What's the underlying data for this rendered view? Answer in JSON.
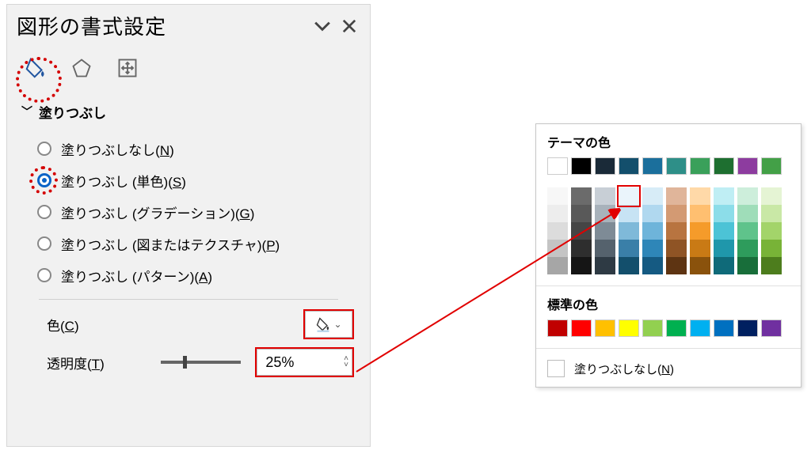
{
  "pane": {
    "title": "図形の書式設定",
    "section_fill": "塗りつぶし",
    "radios": {
      "none": {
        "pre": "塗りつぶしなし(",
        "acc": "N",
        "post": ")"
      },
      "solid": {
        "pre": "塗りつぶし (単色)(",
        "acc": "S",
        "post": ")"
      },
      "gradient": {
        "pre": "塗りつぶし (グラデーション)(",
        "acc": "G",
        "post": ")"
      },
      "picture": {
        "pre": "塗りつぶし (図またはテクスチャ)(",
        "acc": "P",
        "post": ")"
      },
      "pattern": {
        "pre": "塗りつぶし (パターン)(",
        "acc": "A",
        "post": ")"
      }
    },
    "color_label": {
      "pre": "色(",
      "acc": "C",
      "post": ")"
    },
    "trans_label": {
      "pre": "透明度(",
      "acc": "T",
      "post": ")"
    },
    "trans_value": "25%",
    "slider_position_pct": 25
  },
  "color_popup": {
    "theme_title": "テーマの色",
    "std_title": "標準の色",
    "nofill": {
      "pre": "塗りつぶしなし(",
      "acc": "N",
      "post": ")"
    },
    "theme_row": [
      "#ffffff",
      "#000000",
      "#1a2a38",
      "#134f6c",
      "#1b6f9c",
      "#2e8f88",
      "#3aa05a",
      "#1e6f30",
      "#8d3c9f",
      "#43a047"
    ],
    "shade_cols": [
      [
        "#f7f7f7",
        "#ededed",
        "#dcdcdc",
        "#c4c4c4",
        "#a6a6a6"
      ],
      [
        "#6b6b6b",
        "#595959",
        "#454545",
        "#2e2e2e",
        "#151515"
      ],
      [
        "#c8cfd6",
        "#a8b2bb",
        "#7e8b96",
        "#55626d",
        "#2e3a44"
      ],
      [
        "#eaf4fb",
        "#c7e3f4",
        "#7fb9d9",
        "#3a7fa8",
        "#134f6c"
      ],
      [
        "#d7ecf7",
        "#b0d8ef",
        "#6eb4da",
        "#2e86b8",
        "#155a82"
      ],
      [
        "#e0b59a",
        "#d39a73",
        "#b87440",
        "#8f5425",
        "#5e3412"
      ],
      [
        "#ffd9a8",
        "#ffbf70",
        "#f59b2a",
        "#c97a15",
        "#8a520c"
      ],
      [
        "#bfeef4",
        "#8cdde9",
        "#4cc3d6",
        "#1f97ab",
        "#0f6a79"
      ],
      [
        "#cdeedb",
        "#9fddb9",
        "#5fc38b",
        "#2e9c5c",
        "#186e3a"
      ],
      [
        "#e5f4d4",
        "#c9e8a6",
        "#a3d46a",
        "#78b337",
        "#4d7d1d"
      ]
    ],
    "selected_shade": {
      "col": 3,
      "row": 0
    },
    "std_row": [
      "#c00000",
      "#ff0000",
      "#ffc000",
      "#ffff00",
      "#92d050",
      "#00b050",
      "#00b0f0",
      "#0070c0",
      "#002060",
      "#7030a0"
    ]
  }
}
